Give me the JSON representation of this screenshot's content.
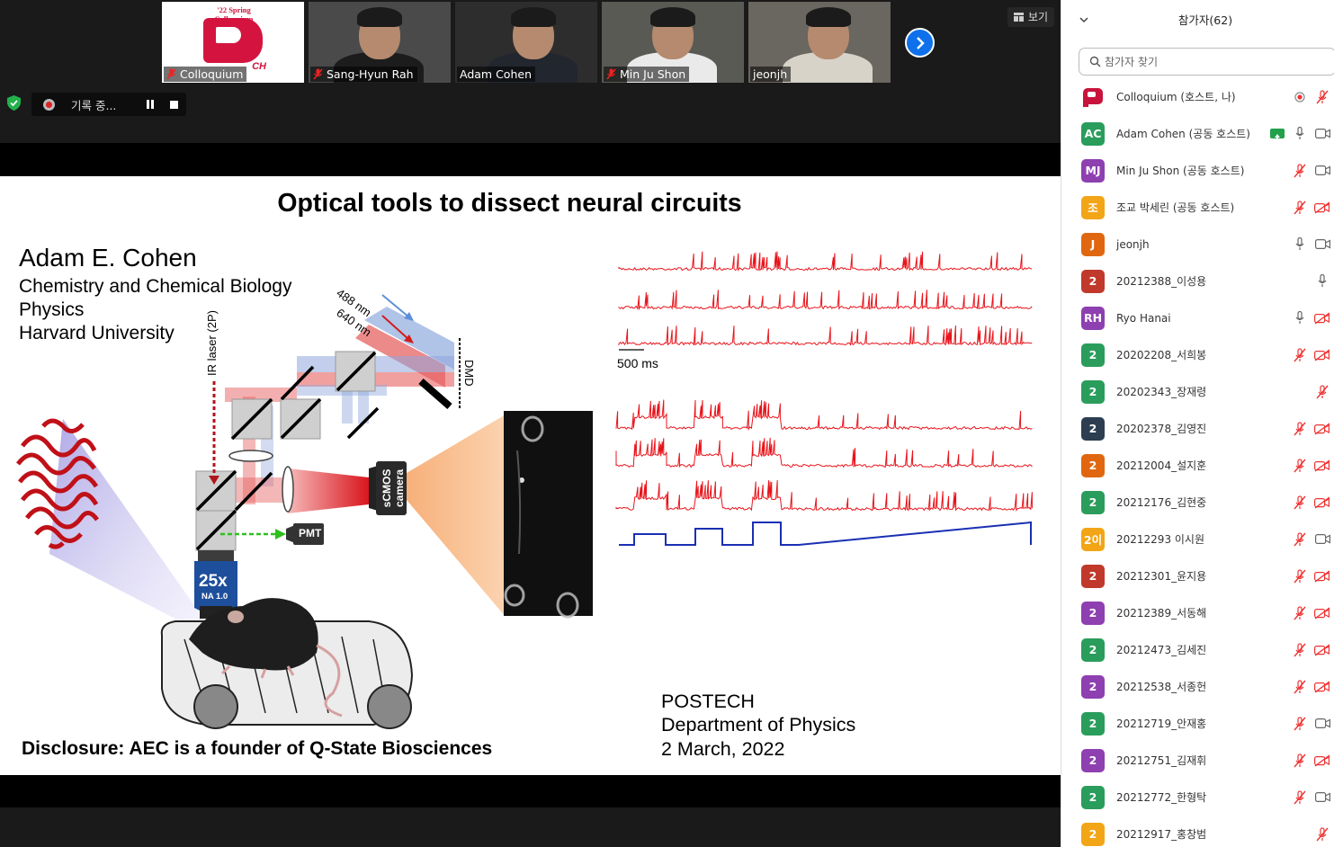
{
  "thumbnails": [
    {
      "name": "Colloquium",
      "muted": true,
      "type": "logo",
      "logo_text": "'22 Spring Colloquium",
      "logo_tail": "CH"
    },
    {
      "name": "Sang-Hyun Rah",
      "muted": true,
      "type": "person"
    },
    {
      "name": "Adam Cohen",
      "muted": false,
      "type": "person",
      "active": true
    },
    {
      "name": "Min Ju Shon",
      "muted": true,
      "type": "person"
    },
    {
      "name": "jeonjh",
      "muted": false,
      "type": "person"
    }
  ],
  "view_button": {
    "label": "보기"
  },
  "recording": {
    "label": "기록 중..."
  },
  "slide": {
    "title": "Optical tools to dissect neural circuits",
    "author": "Adam E. Cohen",
    "affiliations": [
      "Chemistry and Chemical Biology",
      "Physics",
      "Harvard University"
    ],
    "disclosure": "Disclosure: AEC is a founder of Q-State Biosciences",
    "venue": [
      "POSTECH",
      "Department of Physics",
      "2 March, 2022"
    ],
    "diagram_labels": {
      "wl1": "488 nm",
      "wl2": "640 nm",
      "ir": "IR laser (2P)",
      "dmd": "DMD",
      "camera": "sCMOS camera",
      "pmt": "PMT",
      "objective": "25x",
      "na": "NA 1.0",
      "scale": "500 ms"
    },
    "colors": {
      "trace": "#e8141b",
      "stim": "#1a2fb4",
      "beam_blue": "#6f93d6",
      "beam_red": "#e03a3a"
    }
  },
  "panel": {
    "title": "참가자(62)",
    "search_placeholder": "참가자 찾기",
    "participants": [
      {
        "avatar": "logo",
        "color": "#c8143c",
        "name": "Colloquium (호스트, 나)",
        "icons": [
          "record",
          "mic-off"
        ]
      },
      {
        "avatar": "AC",
        "color": "#2a9d5c",
        "name": "Adam Cohen (공동 호스트)",
        "icons": [
          "share",
          "mic",
          "video"
        ]
      },
      {
        "avatar": "MJ",
        "color": "#8e3fb0",
        "name": "Min Ju Shon (공동 호스트)",
        "icons": [
          "mic-off",
          "video"
        ]
      },
      {
        "avatar": "조",
        "color": "#f2a516",
        "name": "조교 박세린 (공동 호스트)",
        "icons": [
          "mic-off",
          "video-off"
        ]
      },
      {
        "avatar": "J",
        "color": "#e0670f",
        "name": "jeonjh",
        "icons": [
          "mic",
          "video"
        ]
      },
      {
        "avatar": "2",
        "color": "#c0392b",
        "name": "20212388_이성용",
        "icons": [
          "mic"
        ]
      },
      {
        "avatar": "RH",
        "color": "#8e3fb0",
        "name": "Ryo Hanai",
        "icons": [
          "mic",
          "video-off"
        ]
      },
      {
        "avatar": "2",
        "color": "#2a9d5c",
        "name": "20202208_서희봉",
        "icons": [
          "mic-off",
          "video-off"
        ]
      },
      {
        "avatar": "2",
        "color": "#2a9d5c",
        "name": "20202343_장재령",
        "icons": [
          "mic-off"
        ]
      },
      {
        "avatar": "2",
        "color": "#2c3e50",
        "name": "20202378_김영진",
        "icons": [
          "mic-off",
          "video-off"
        ]
      },
      {
        "avatar": "2",
        "color": "#e0670f",
        "name": "20212004_설지훈",
        "icons": [
          "mic-off",
          "video-off"
        ]
      },
      {
        "avatar": "2",
        "color": "#2a9d5c",
        "name": "20212176_김현중",
        "icons": [
          "mic-off",
          "video-off"
        ]
      },
      {
        "avatar": "2이",
        "color": "#f2a516",
        "name": "20212293 이시원",
        "icons": [
          "mic-off",
          "video"
        ]
      },
      {
        "avatar": "2",
        "color": "#c0392b",
        "name": "20212301_윤지용",
        "icons": [
          "mic-off",
          "video-off"
        ]
      },
      {
        "avatar": "2",
        "color": "#8e3fb0",
        "name": "20212389_서동해",
        "icons": [
          "mic-off",
          "video-off"
        ]
      },
      {
        "avatar": "2",
        "color": "#2a9d5c",
        "name": "20212473_김세진",
        "icons": [
          "mic-off",
          "video-off"
        ]
      },
      {
        "avatar": "2",
        "color": "#8e3fb0",
        "name": "20212538_서종헌",
        "icons": [
          "mic-off",
          "video-off"
        ]
      },
      {
        "avatar": "2",
        "color": "#2a9d5c",
        "name": "20212719_안재홍",
        "icons": [
          "mic-off",
          "video"
        ]
      },
      {
        "avatar": "2",
        "color": "#8e3fb0",
        "name": "20212751_김재휘",
        "icons": [
          "mic-off",
          "video-off"
        ]
      },
      {
        "avatar": "2",
        "color": "#2a9d5c",
        "name": "20212772_한형탁",
        "icons": [
          "mic-off",
          "video"
        ]
      },
      {
        "avatar": "2",
        "color": "#f2a516",
        "name": "20212917_홍창범",
        "icons": [
          "mic-off"
        ]
      }
    ]
  }
}
